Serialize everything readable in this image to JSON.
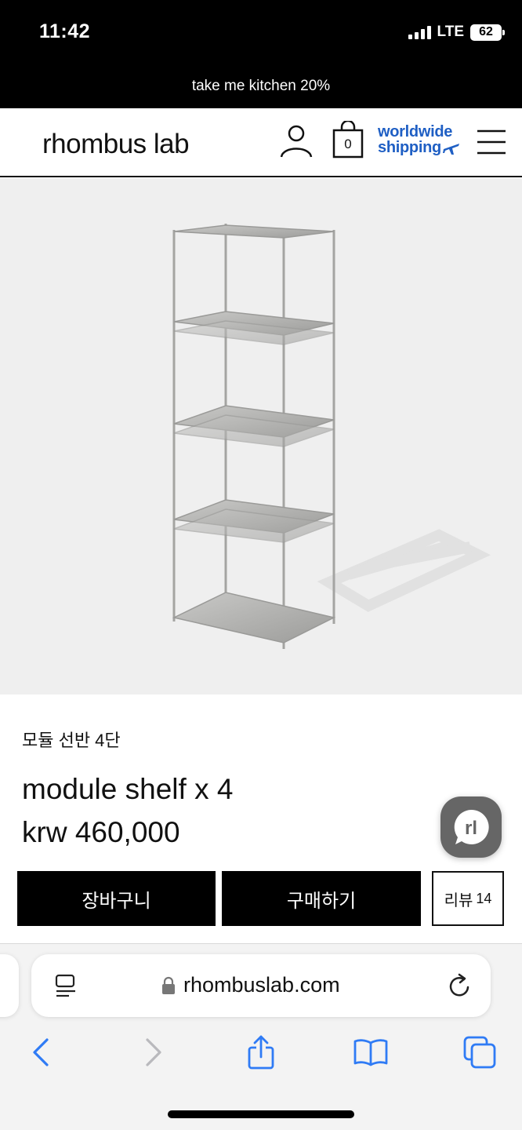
{
  "status_bar": {
    "time": "11:42",
    "network": "LTE",
    "battery": "62"
  },
  "promo": {
    "text": "take me kitchen 20%"
  },
  "header": {
    "logo": "rhombus lab",
    "cart_count": "0",
    "shipping_line1": "worldwide",
    "shipping_line2": "shipping",
    "accent_color": "#1f5fc4"
  },
  "product": {
    "name_ko": "모듈 선반 4단",
    "name": "module shelf x 4",
    "price": "krw 460,000",
    "image_icon": "shelf-product-photo"
  },
  "chat": {
    "label": "rl"
  },
  "actions": {
    "cart_label": "장바구니",
    "buy_label": "구매하기",
    "review_label": "리뷰",
    "review_count": "14"
  },
  "browser": {
    "url": "rhombuslab.com"
  }
}
